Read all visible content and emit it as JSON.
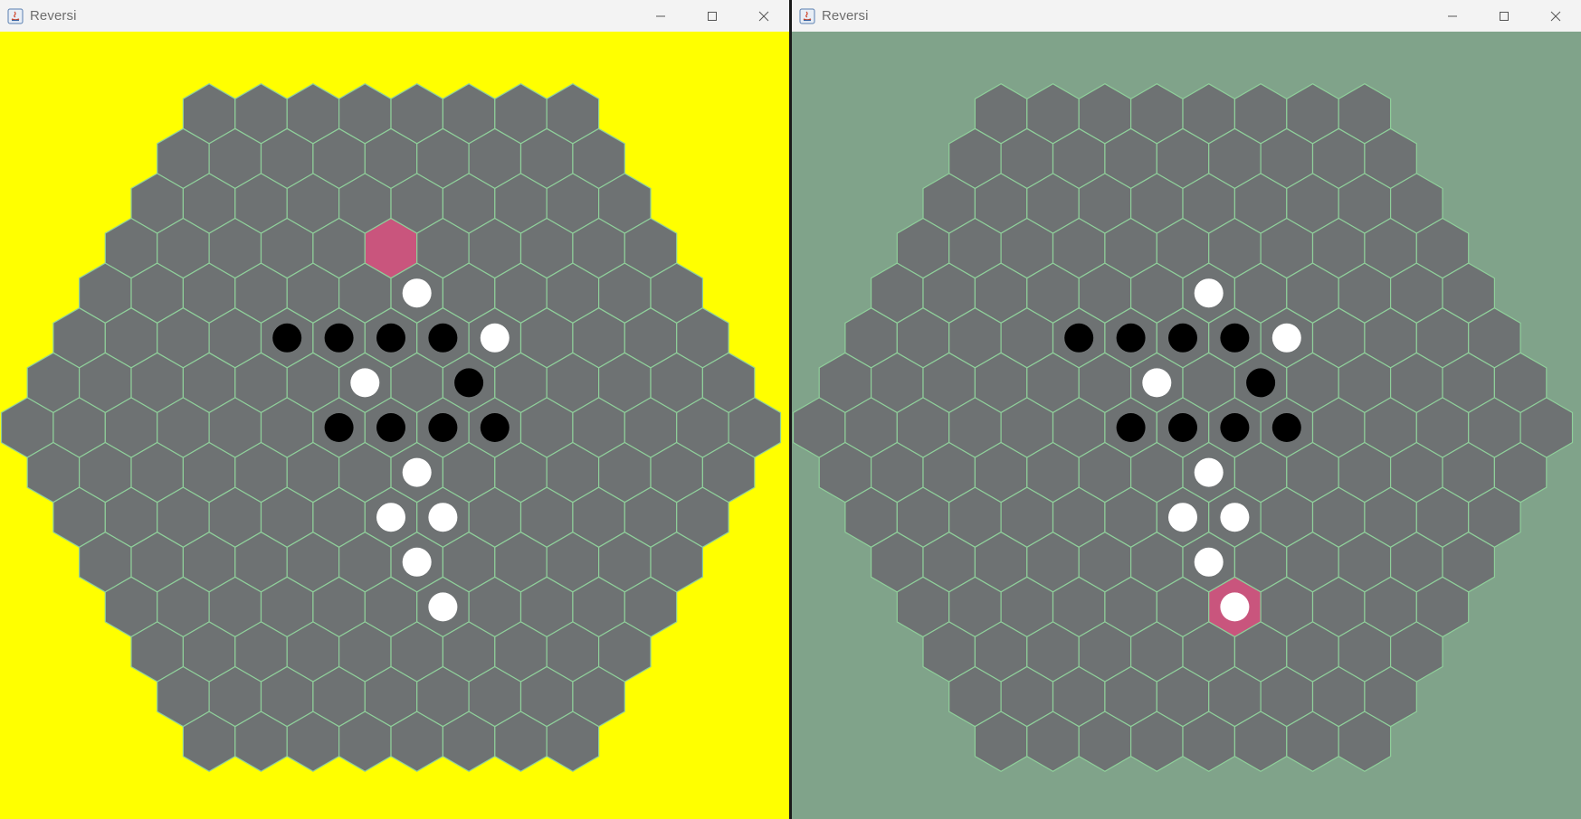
{
  "windows": [
    {
      "id": "left",
      "title": "Reversi",
      "background": "#ffff00",
      "highlight": [
        2,
        -4
      ]
    },
    {
      "id": "right",
      "title": "Reversi",
      "background": "#80a38a",
      "highlight": [
        -1,
        4
      ]
    }
  ],
  "board": {
    "radius": 7,
    "cell_color": "#6e7273",
    "border_color": "#8fcf9a",
    "highlight_color": "#c9557d",
    "black_color": "#000000",
    "white_color": "#ffffff",
    "pieces": [
      {
        "q": 2,
        "r": -3,
        "player": "white"
      },
      {
        "q": 3,
        "r": -2,
        "player": "white"
      },
      {
        "q": 2,
        "r": -2,
        "player": "black"
      },
      {
        "q": 1,
        "r": -2,
        "player": "black"
      },
      {
        "q": 0,
        "r": -2,
        "player": "black"
      },
      {
        "q": -1,
        "r": -2,
        "player": "black"
      },
      {
        "q": 0,
        "r": -1,
        "player": "white"
      },
      {
        "q": 2,
        "r": -1,
        "player": "black"
      },
      {
        "q": -1,
        "r": 0,
        "player": "black"
      },
      {
        "q": 0,
        "r": 0,
        "player": "black"
      },
      {
        "q": 1,
        "r": 0,
        "player": "black"
      },
      {
        "q": 2,
        "r": 0,
        "player": "black"
      },
      {
        "q": 0,
        "r": 1,
        "player": "white"
      },
      {
        "q": -1,
        "r": 2,
        "player": "white"
      },
      {
        "q": 0,
        "r": 2,
        "player": "white"
      },
      {
        "q": -1,
        "r": 3,
        "player": "white"
      },
      {
        "q": -1,
        "r": 4,
        "player": "white"
      }
    ]
  },
  "controls": {
    "minimize_icon": "minimize-icon",
    "maximize_icon": "maximize-icon",
    "close_icon": "close-icon"
  }
}
